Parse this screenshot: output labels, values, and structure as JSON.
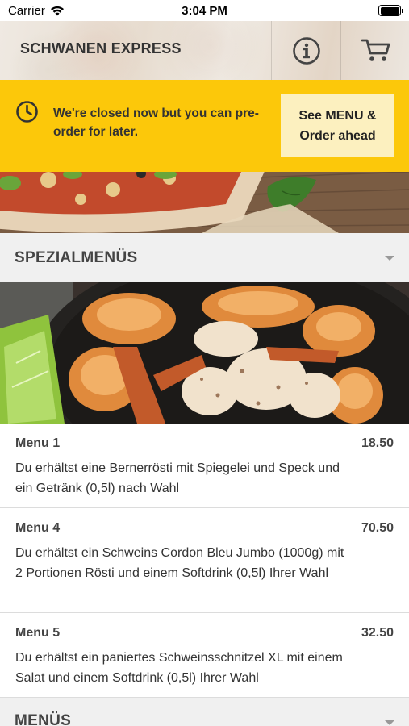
{
  "status_bar": {
    "carrier": "Carrier",
    "time": "3:04 PM"
  },
  "header": {
    "brand": "SCHWANEN EXPRESS"
  },
  "banner": {
    "message": "We're closed now but you can pre-order for later.",
    "button_line1": "See MENU &",
    "button_line2": "Order ahead"
  },
  "sections": [
    {
      "title": "SPEZIALMENÜS"
    },
    {
      "title": "MENÜS"
    }
  ],
  "menu_items": [
    {
      "name": "Menu 1",
      "price": "18.50",
      "description": "Du erhältst eine Bernerrösti mit Spiegelei und Speck und ein Getränk (0,5l) nach Wahl"
    },
    {
      "name": "Menu 4",
      "price": "70.50",
      "description": "Du erhältst ein Schweins Cordon Bleu Jumbo (1000g) mit 2 Portionen Rösti und einem Softdrink (0,5l) Ihrer Wahl"
    },
    {
      "name": "Menu 5",
      "price": "32.50",
      "description": "Du erhältst ein paniertes Schweinsschnitzel XL mit einem Salat und einem Softdrink (0,5l) Ihrer Wahl"
    }
  ],
  "colors": {
    "accent_yellow": "#fcc80a",
    "button_bg": "#fcf0bf",
    "section_bg": "#f0f0f0"
  },
  "icons": [
    "wifi-icon",
    "battery-icon",
    "info-icon",
    "cart-icon",
    "clock-icon",
    "chevron-down-icon"
  ]
}
